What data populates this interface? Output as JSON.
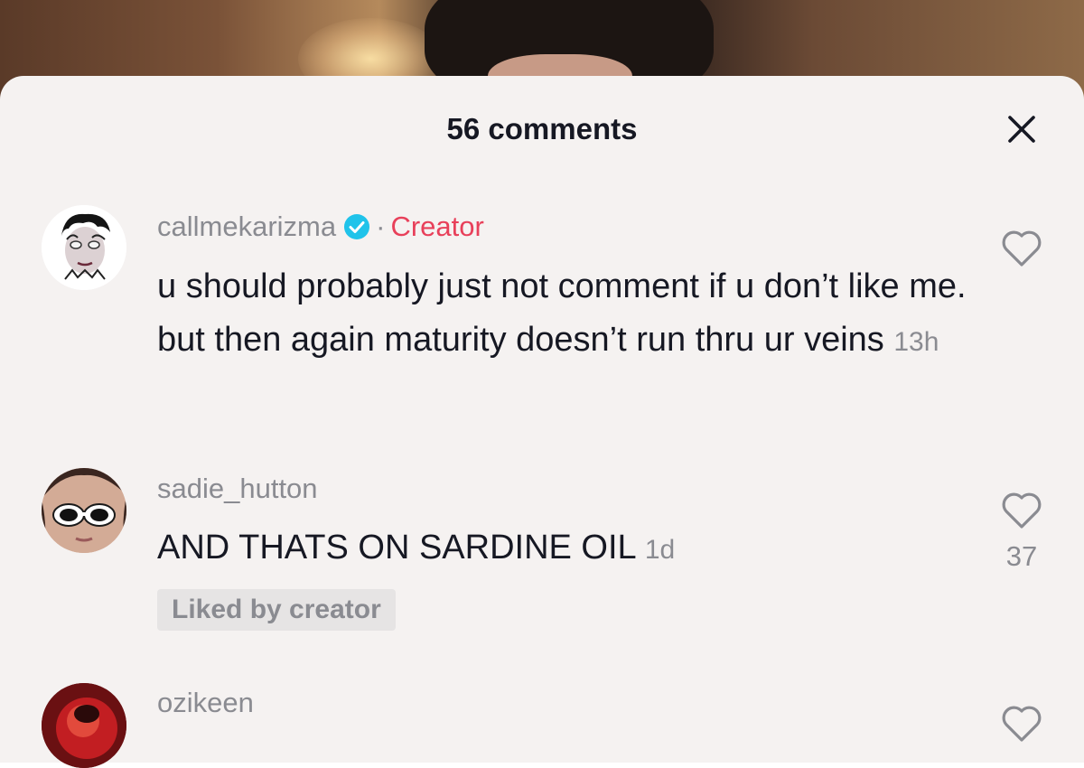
{
  "header": {
    "title": "56 comments"
  },
  "comments": [
    {
      "username": "callmekarizma",
      "verified": true,
      "separator": "·",
      "creator_label": "Creator",
      "text": "u should probably just not comment if u don’t like me. but then again maturity doesn’t run thru ur veins",
      "time": "13h",
      "like_count": ""
    },
    {
      "username": "sadie_hutton",
      "text": "AND THATS ON SARDINE OIL",
      "time": "1d",
      "like_count": "37",
      "liked_by_label": "Liked by creator"
    },
    {
      "username": "ozikeen"
    }
  ],
  "colors": {
    "creator_accent": "#e8405a",
    "verified_badge": "#20c3ea",
    "text_primary": "#161823",
    "text_secondary": "#8a8b91",
    "panel_bg": "#f5f2f1"
  },
  "icons": {
    "close": "close-icon",
    "like": "heart-outline-icon",
    "verified": "verified-badge-icon"
  }
}
